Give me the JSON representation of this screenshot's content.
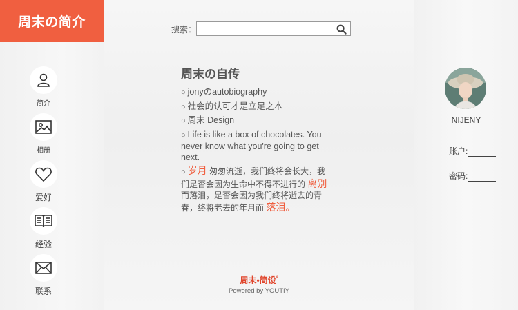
{
  "brand": {
    "title": "周末の简介"
  },
  "nav": [
    {
      "label": "简介",
      "icon": "user-icon"
    },
    {
      "label": "相册",
      "icon": "image-icon"
    },
    {
      "label": "爱好",
      "icon": "heart-icon"
    },
    {
      "label": "经验",
      "icon": "book-icon"
    },
    {
      "label": "联系",
      "icon": "mail-icon"
    }
  ],
  "search": {
    "label": "搜索：",
    "value": "",
    "placeholder": ""
  },
  "bio": {
    "title": "周末の自传",
    "bullet": "○",
    "items": [
      "jonyのautobiography",
      "社会的认可才是立足之本",
      "周末 Design",
      "Life is like a box of chocolates. You never know what you're going to get next."
    ],
    "poem": {
      "hl1": "岁月",
      "part1": " 匆匆流逝，我们终将会长大，我们是否会因为生命中不得不进行的 ",
      "hl2": "离别",
      "part2": " 而落泪，是否会因为我们终将逝去的青春，终将老去的年月而 ",
      "hl3": "落泪。"
    }
  },
  "footer": {
    "logo": "周末•简设",
    "logo_mark": "°",
    "credit": "Powered by YOUTIY"
  },
  "user": {
    "name": "NIJENY",
    "account_label": "账户:",
    "password_label": "密码:"
  },
  "colors": {
    "accent": "#f05f40"
  }
}
